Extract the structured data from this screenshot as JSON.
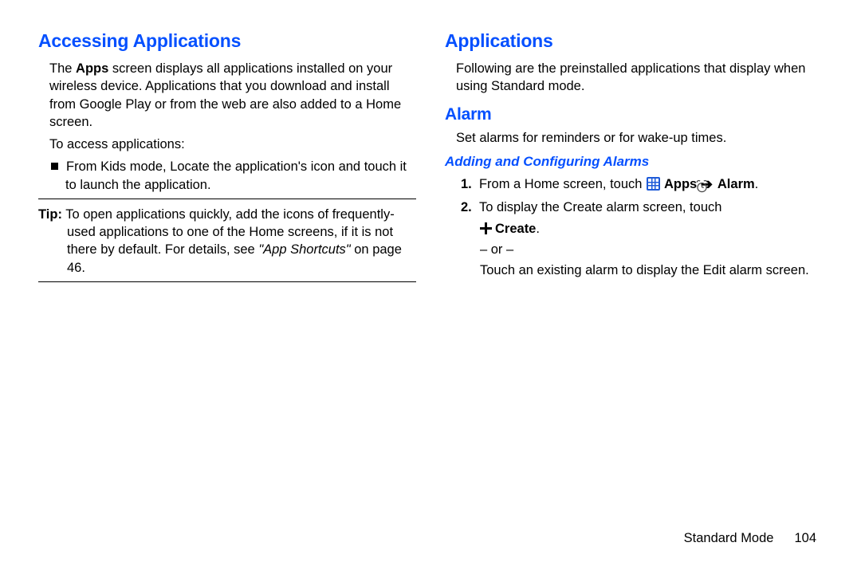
{
  "left": {
    "heading": "Accessing Applications",
    "para1_pre": "The ",
    "para1_bold": "Apps",
    "para1_post": " screen displays all applications installed on your wireless device. Applications that you download and install from Google Play or from the web are also added to a Home screen.",
    "para2": "To access applications:",
    "bullet1": "From Kids mode, Locate the application's icon and touch it to launch the application.",
    "tip_label": "Tip:",
    "tip_body_a": " To open applications quickly, add the icons of frequently-used applications to one of the Home screens, if it is not there by default. For details, see ",
    "tip_body_i": "\"App Shortcuts\"",
    "tip_body_b": " on page 46."
  },
  "right": {
    "heading1": "Applications",
    "para1": "Following are the preinstalled applications that display when using Standard mode.",
    "heading2": "Alarm",
    "para2": "Set alarms for reminders or for wake-up times.",
    "heading3": "Adding and Configuring Alarms",
    "step1_num": "1.",
    "step1_a": "From a Home screen, touch ",
    "step1_apps": " Apps ",
    "step1_alarm": " Alarm",
    "step1_end": ".",
    "step2_num": "2.",
    "step2_a": "To display the Create alarm screen, touch",
    "step2_create": "Create",
    "step2_end": ".",
    "or": "– or –",
    "para3": "Touch an existing alarm to display the Edit alarm screen."
  },
  "footer": {
    "section": "Standard Mode",
    "page": "104"
  }
}
